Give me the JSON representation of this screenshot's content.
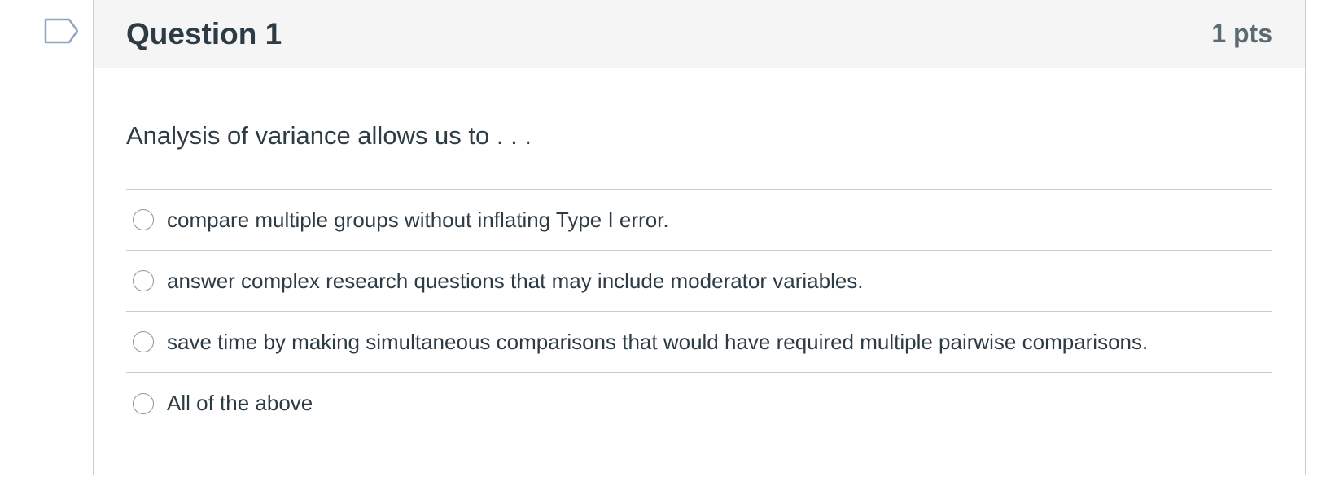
{
  "question": {
    "title": "Question 1",
    "points": "1 pts",
    "text": "Analysis of variance allows us to . . .",
    "answers": [
      {
        "label": "compare multiple groups without inflating Type I error."
      },
      {
        "label": "answer complex research questions that may include moderator variables."
      },
      {
        "label": "save time by making simultaneous comparisons that would have required multiple pairwise comparisons."
      },
      {
        "label": "All of the above"
      }
    ]
  },
  "colors": {
    "text": "#2d3b45",
    "points": "#5c6a74",
    "header_bg": "#f5f5f5",
    "border": "#c7cdd1",
    "flag_outline": "#8fa7c0"
  },
  "icons": {
    "flag": "flag-icon",
    "radio": "radio-unselected"
  }
}
